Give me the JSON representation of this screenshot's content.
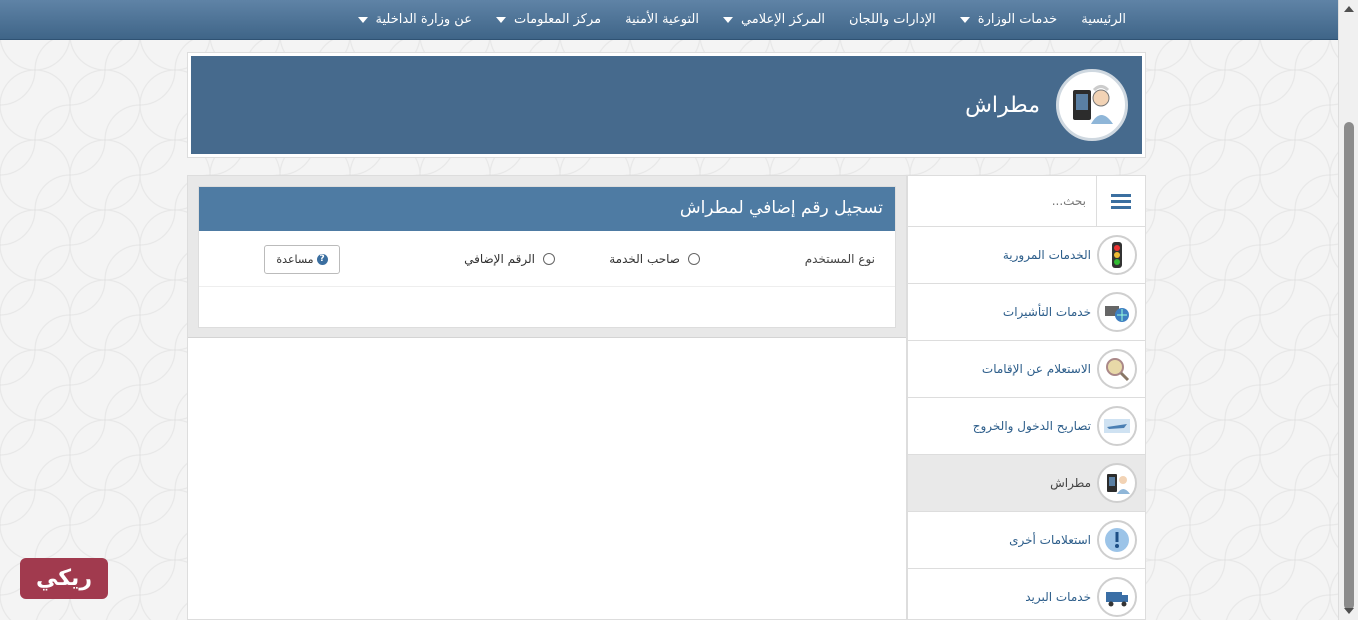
{
  "topnav": {
    "items": [
      {
        "label": "الرئيسية",
        "dropdown": false
      },
      {
        "label": "خدمات الوزارة",
        "dropdown": true
      },
      {
        "label": "الإدارات واللجان",
        "dropdown": false
      },
      {
        "label": "المركز الإعلامي",
        "dropdown": true
      },
      {
        "label": "التوعية الأمنية",
        "dropdown": false
      },
      {
        "label": "مركز المعلومات",
        "dropdown": true
      },
      {
        "label": "عن وزارة الداخلية",
        "dropdown": true
      }
    ]
  },
  "banner": {
    "title": "مطراش",
    "icon": "mutrash-logo-icon"
  },
  "form": {
    "title": "تسجيل رقم إضافي لمطراش",
    "user_type_label": "نوع المستخدم",
    "options": [
      "صاحب الخدمة",
      "الرقم الإضافي"
    ],
    "selected_option": null,
    "help_label": "مساعدة"
  },
  "sidebar": {
    "search_placeholder": "بحث...",
    "items": [
      {
        "label": "الخدمات المرورية",
        "icon": "traffic-light-icon",
        "active": false
      },
      {
        "label": "خدمات التأشيرات",
        "icon": "visa-icon",
        "active": false
      },
      {
        "label": "الاستعلام عن الإقامات",
        "icon": "magnifier-icon",
        "active": false
      },
      {
        "label": "تصاريح الدخول والخروج",
        "icon": "airplane-icon",
        "active": false
      },
      {
        "label": "مطراش",
        "icon": "mutrash-icon",
        "active": true
      },
      {
        "label": "استعلامات أخرى",
        "icon": "exclamation-icon",
        "active": false
      },
      {
        "label": "خدمات البريد",
        "icon": "mail-truck-icon",
        "active": false
      }
    ]
  },
  "watermark": {
    "text": "ريكي"
  },
  "colors": {
    "nav": "#4f7497",
    "banner": "#466a8d",
    "card_header": "#4e7ba3",
    "link": "#2c5d8a",
    "watermark": "#a13a4e"
  }
}
